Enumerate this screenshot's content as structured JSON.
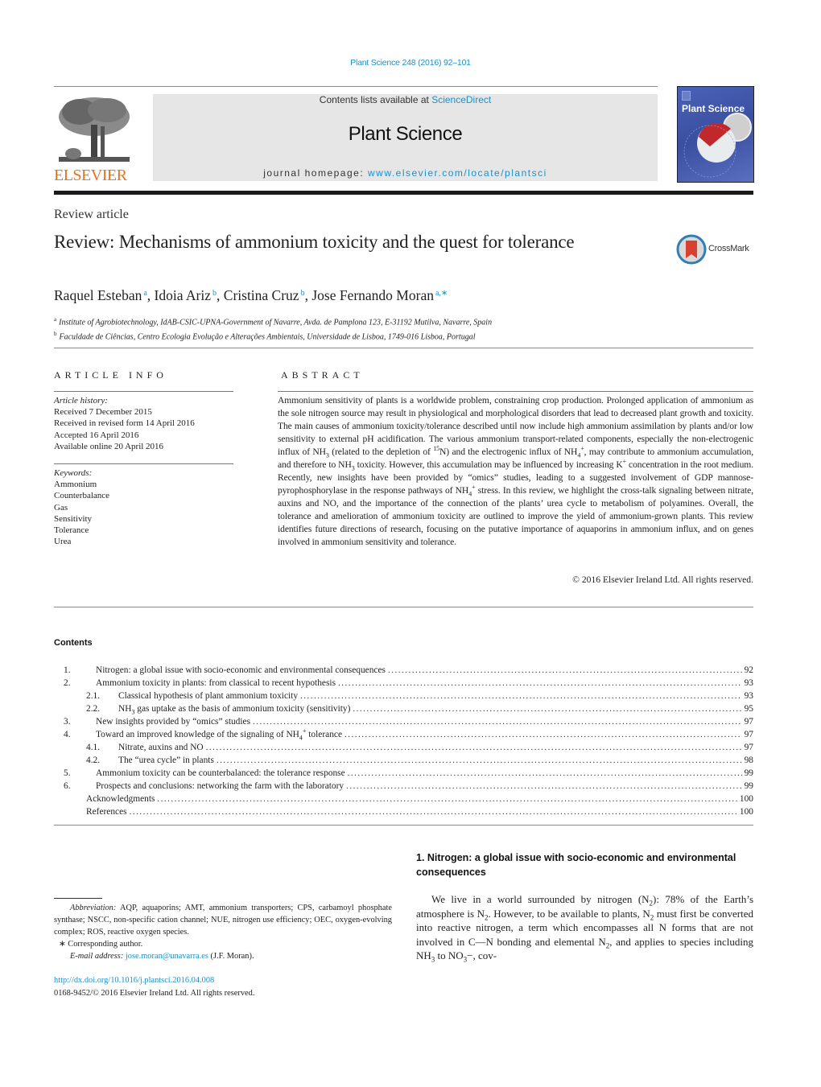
{
  "header": {
    "citation": "Plant Science 248 (2016) 92–101",
    "contents_prefix": "Contents lists available at ",
    "contents_link": "ScienceDirect",
    "journal_name": "Plant Science",
    "homepage_prefix": "journal homepage: ",
    "homepage_link": "www.elsevier.com/locate/plantsci",
    "publisher_logo_text": "ELSEVIER",
    "cover_title": "Plant Science",
    "crossmark_label": "CrossMark",
    "colors": {
      "link": "#1f8fc4",
      "elsevier_orange": "#e9711c",
      "header_bg": "#e6e6e6",
      "cover_blue": "#4a62b8"
    }
  },
  "article": {
    "type": "Review article",
    "title": "Review: Mechanisms of ammonium toxicity and the quest for tolerance",
    "authors": [
      {
        "name": "Raquel Esteban",
        "sup": "a"
      },
      {
        "name": "Idoia Ariz",
        "sup": "b"
      },
      {
        "name": "Cristina Cruz",
        "sup": "b"
      },
      {
        "name": "Jose Fernando Moran",
        "sup": "a,∗"
      }
    ],
    "affiliations": [
      {
        "mark": "a",
        "text": "Institute of Agrobiotechnology, IdAB-CSIC-UPNA-Government of Navarre, Avda. de Pamplona 123, E-31192 Mutilva, Navarre, Spain"
      },
      {
        "mark": "b",
        "text": "Faculdade de Ciências, Centro Ecologia Evolução e Alterações Ambientais, Universidade de Lisboa, 1749-016 Lisboa, Portugal"
      }
    ]
  },
  "article_info": {
    "heading": "ARTICLE INFO",
    "history_label": "Article history:",
    "history": [
      "Received 7 December 2015",
      "Received in revised form 14 April 2016",
      "Accepted 16 April 2016",
      "Available online 20 April 2016"
    ],
    "keywords_label": "Keywords:",
    "keywords": [
      "Ammonium",
      "Counterbalance",
      "Gas",
      "Sensitivity",
      "Tolerance",
      "Urea"
    ]
  },
  "abstract": {
    "heading": "ABSTRACT",
    "parts": {
      "p1": "Ammonium sensitivity of plants is a worldwide problem, constraining crop production. Prolonged application of ammonium as the sole nitrogen source may result in physiological and morphological disorders that lead to decreased plant growth and toxicity. The main causes of ammonium toxicity/tolerance described until now include high ammonium assimilation by plants and/or low sensitivity to external pH acidification. The various ammonium transport-related components, especially the non-electrogenic influx of NH",
      "p2": " (related to the depletion of ",
      "p3": "N) and the electrogenic influx of NH",
      "p4": ", may contribute to ammonium accumulation, and therefore to NH",
      "p5": " toxicity. However, this accumulation may be influenced by increasing K",
      "p6": " concentration in the root medium. Recently, new insights have been provided by “omics” studies, leading to a suggested involvement of GDP mannose-pyrophosphorylase in the response pathways of NH",
      "p7": " stress. In this review, we highlight the cross-talk signaling between nitrate, auxins and NO, and the importance of the connection of the plants’ urea cycle to metabolism of polyamines. Overall, the tolerance and amelioration of ammonium toxicity are outlined to improve the yield of ammonium-grown plants. This review identifies future directions of research, focusing on the putative importance of aquaporins in ammonium influx, and on genes involved in ammonium sensitivity and tolerance.",
      "sub3": "3",
      "sup15": "15",
      "sub4": "4",
      "supplus": "+"
    },
    "copyright": "© 2016 Elsevier Ireland Ltd. All rights reserved."
  },
  "contents": {
    "title": "Contents",
    "items": [
      {
        "num": "1.",
        "level": 1,
        "label": "Nitrogen: a global issue with socio-economic and environmental consequences",
        "page": "92"
      },
      {
        "num": "2.",
        "level": 1,
        "label": "Ammonium toxicity in plants: from classical to recent hypothesis",
        "page": "93"
      },
      {
        "num": "2.1.",
        "level": 2,
        "label": "Classical hypothesis of plant ammonium toxicity",
        "page": "93"
      },
      {
        "num": "2.2.",
        "level": 2,
        "label_pre": "NH",
        "label_sub": "3",
        "label_post": " gas uptake as the basis of ammonium toxicity (sensitivity)",
        "page": "95"
      },
      {
        "num": "3.",
        "level": 1,
        "label": "New insights provided by “omics” studies",
        "page": "97"
      },
      {
        "num": "4.",
        "level": 1,
        "label_pre": "Toward an improved knowledge of the signaling of NH",
        "label_sub": "4",
        "label_sup": "+",
        "label_post": " tolerance",
        "page": "97"
      },
      {
        "num": "4.1.",
        "level": 2,
        "label": "Nitrate, auxins and NO",
        "page": "97"
      },
      {
        "num": "4.2.",
        "level": 2,
        "label": "The “urea cycle” in plants",
        "page": "98"
      },
      {
        "num": "5.",
        "level": 1,
        "label": "Ammonium toxicity can be counterbalanced: the tolerance response",
        "page": "99"
      },
      {
        "num": "6.",
        "level": 1,
        "label": "Prospects and conclusions: networking the farm with the laboratory",
        "page": "99"
      },
      {
        "num": "",
        "level": 0,
        "label": "Acknowledgments",
        "page": "100"
      },
      {
        "num": "",
        "level": 0,
        "label": "References",
        "page": "100"
      }
    ]
  },
  "section1": {
    "heading": "1.  Nitrogen: a global issue with socio-economic and environmental consequences",
    "t1": "We live in a world surrounded by nitrogen (N",
    "t2": "): 78% of the Earth’s atmosphere is N",
    "t3": ". However, to be available to plants, N",
    "t4": " must first be converted into reactive nitrogen, a term which encompasses all N forms that are not involved in C—N bonding and elemental N",
    "t5": ", and applies to species including NH",
    "t6": " to NO",
    "t7": "−, cov-",
    "sub2": "2",
    "sub3": "3"
  },
  "footnotes": {
    "abbrev_label": "Abbreviation:",
    "abbrev_text": " AQP, aquaporins; AMT, ammonium transporters; CPS, carbamoyl phosphate synthase; NSCC, non-specific cation channel; NUE, nitrogen use efficiency; OEC, oxygen-evolving complex; ROS, reactive oxygen species.",
    "corresponding": "∗  Corresponding author.",
    "email_label": "E-mail address:",
    "email": "jose.moran@unavarra.es",
    "email_suffix": " (J.F. Moran).",
    "doi": "http://dx.doi.org/10.1016/j.plantsci.2016.04.008",
    "issn": "0168-9452/© 2016 Elsevier Ireland Ltd. All rights reserved."
  }
}
